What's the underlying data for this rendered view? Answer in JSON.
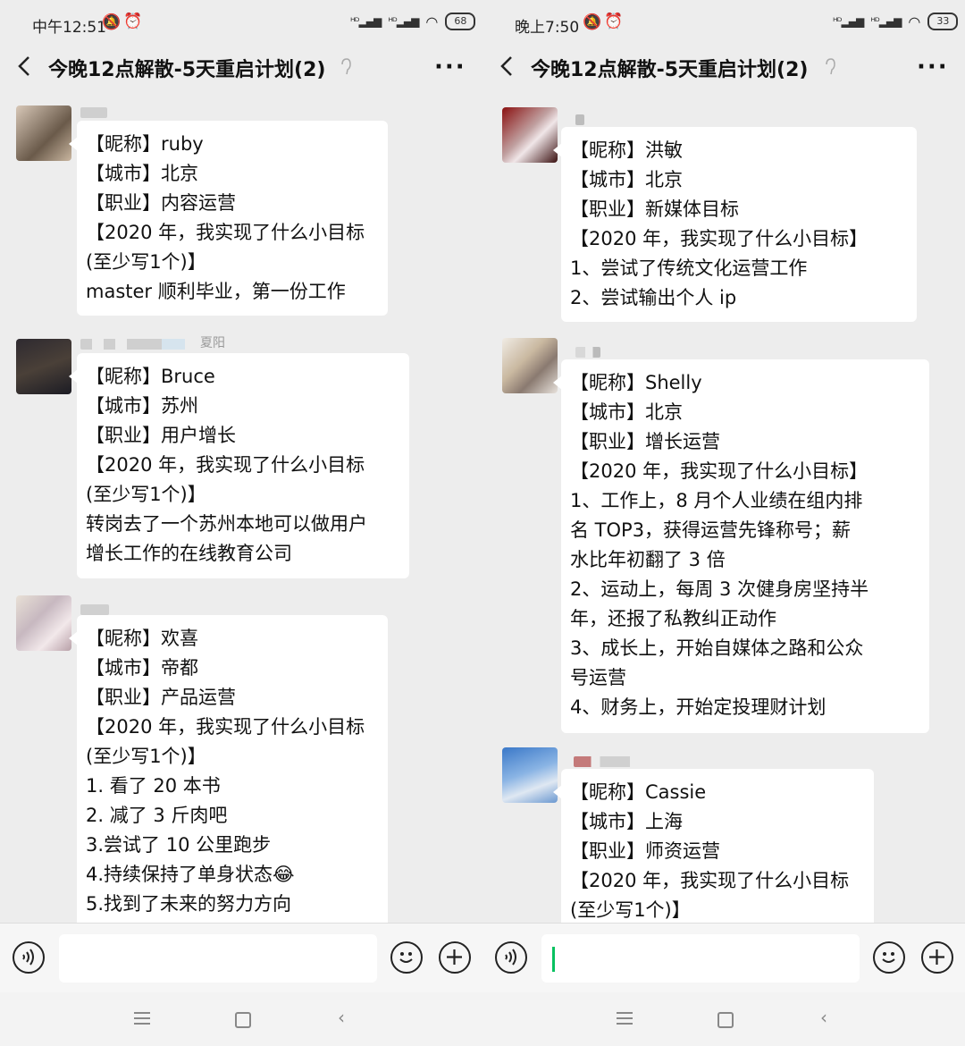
{
  "screens": [
    {
      "status_time": "中午12:51",
      "battery": "68",
      "title": "今晚12点解散-5天重启计划(2)",
      "messages": [
        {
          "lines": [
            "【昵称】ruby",
            "【城市】北京",
            "【职业】内容运营",
            "【2020 年，我实现了什么小目标",
            "(至少写1个)】",
            "master 顺利毕业，第一份工作"
          ]
        },
        {
          "name_tail": "夏阳",
          "lines": [
            "【昵称】Bruce",
            "【城市】苏州",
            "【职业】用户增长",
            "【2020 年，我实现了什么小目标",
            "(至少写1个)】",
            "转岗去了一个苏州本地可以做用户",
            "增长工作的在线教育公司"
          ]
        },
        {
          "lines": [
            "【昵称】欢喜",
            "【城市】帝都",
            "【职业】产品运营",
            "【2020 年，我实现了什么小目标",
            "(至少写1个)】",
            "1. 看了 20 本书",
            "2. 减了 3 斤肉吧",
            "3.尝试了 10 公里跑步",
            "4.持续保持了单身状态😂",
            "5.找到了未来的努力方向"
          ]
        }
      ]
    },
    {
      "status_time": "晚上7:50",
      "battery": "33",
      "title": "今晚12点解散-5天重启计划(2)",
      "messages": [
        {
          "lines": [
            "【昵称】洪敏",
            "【城市】北京",
            "【职业】新媒体目标",
            "【2020 年，我实现了什么小目标】",
            "1、尝试了传统文化运营工作",
            "2、尝试输出个人 ip"
          ]
        },
        {
          "lines": [
            "【昵称】Shelly",
            "【城市】北京",
            "【职业】增长运营",
            "【2020 年，我实现了什么小目标】",
            "1、工作上，8 月个人业绩在组内排",
            "名 TOP3，获得运营先锋称号；薪",
            "水比年初翻了 3 倍",
            "2、运动上，每周 3 次健身房坚持半",
            "年，还报了私教纠正动作",
            "3、成长上，开始自媒体之路和公众",
            "号运营",
            "4、财务上，开始定投理财计划"
          ]
        },
        {
          "lines": [
            "【昵称】Cassie",
            "【城市】上海",
            "【职业】师资运营",
            "【2020 年，我实现了什么小目标",
            "(至少写1个)】"
          ]
        }
      ]
    }
  ]
}
